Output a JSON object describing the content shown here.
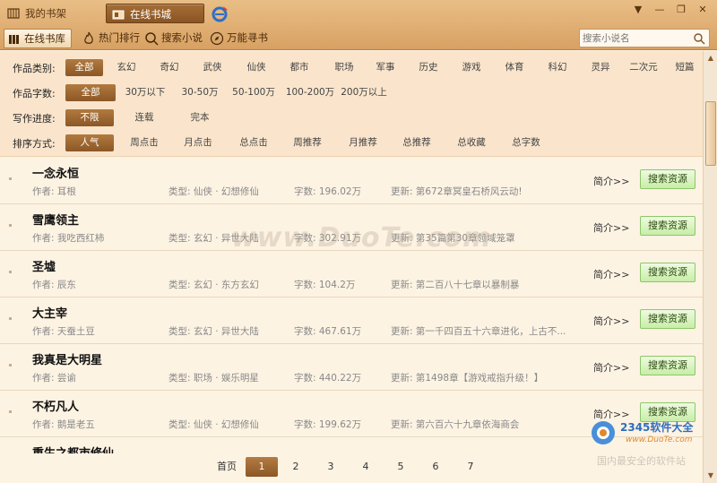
{
  "tabs": {
    "shelf": "我的书架",
    "online": "在线书城"
  },
  "window_controls": {
    "menu": "▼",
    "minimize": "—",
    "restore": "❐",
    "close": "✕"
  },
  "nav": {
    "library": "在线书库",
    "ranking": "热门排行",
    "search": "搜索小说",
    "finder": "万能寻书"
  },
  "search": {
    "placeholder": "搜索小说名"
  },
  "filters": {
    "category": {
      "label": "作品类别:",
      "options": [
        "全部",
        "玄幻",
        "奇幻",
        "武侠",
        "仙侠",
        "都市",
        "职场",
        "军事",
        "历史",
        "游戏",
        "体育",
        "科幻",
        "灵异",
        "二次元",
        "短篇"
      ]
    },
    "wordcount": {
      "label": "作品字数:",
      "options": [
        "全部",
        "30万以下",
        "30-50万",
        "50-100万",
        "100-200万",
        "200万以上"
      ]
    },
    "progress": {
      "label": "写作进度:",
      "options": [
        "不限",
        "连载",
        "完本"
      ]
    },
    "sort": {
      "label": "排序方式:",
      "options": [
        "人气",
        "周点击",
        "月点击",
        "总点击",
        "周推荐",
        "月推荐",
        "总推荐",
        "总收藏",
        "总字数"
      ]
    }
  },
  "books": [
    {
      "title": "一念永恒",
      "author": "作者: 耳根",
      "type": "类型: 仙侠 · 幻想修仙",
      "count": "字数: 196.02万",
      "update": "更新: 第672章冥皇石桥风云动!",
      "intro": "简介>>",
      "button": "搜索资源"
    },
    {
      "title": "雪鹰领主",
      "author": "作者: 我吃西红柿",
      "type": "类型: 玄幻 · 异世大陆",
      "count": "字数: 302.91万",
      "update": "更新: 第35篇第30章领域笼罩",
      "intro": "简介>>",
      "button": "搜索资源"
    },
    {
      "title": "圣墟",
      "author": "作者: 辰东",
      "type": "类型: 玄幻 · 东方玄幻",
      "count": "字数: 104.2万",
      "update": "更新: 第二百八十七章以暴制暴",
      "intro": "简介>>",
      "button": "搜索资源"
    },
    {
      "title": "大主宰",
      "author": "作者: 天蚕土豆",
      "type": "类型: 玄幻 · 异世大陆",
      "count": "字数: 467.61万",
      "update": "更新: 第一千四百五十六章进化，上古不...",
      "intro": "简介>>",
      "button": "搜索资源"
    },
    {
      "title": "我真是大明星",
      "author": "作者: 尝谕",
      "type": "类型: 职场 · 娱乐明星",
      "count": "字数: 440.22万",
      "update": "更新: 第1498章【游戏戒指升级！】",
      "intro": "简介>>",
      "button": "搜索资源"
    },
    {
      "title": "不朽凡人",
      "author": "作者: 鹅是老五",
      "type": "类型: 仙侠 · 幻想修仙",
      "count": "字数: 199.62万",
      "update": "更新: 第六百六十九章依海商会",
      "intro": "简介>>",
      "button": "搜索资源"
    },
    {
      "title": "重生之都市修仙",
      "author": "",
      "type": "",
      "count": "",
      "update": "",
      "intro": "",
      "button": ""
    }
  ],
  "pager": {
    "first": "首页",
    "pages": [
      "1",
      "2",
      "3",
      "4",
      "5",
      "6",
      "7"
    ],
    "current": "1"
  },
  "watermark": {
    "main": "www.DuoTe.com",
    "site_name": "2345软件大全",
    "site_url": "www.DuoTe.com",
    "site_sub": "国内最安全的软件站"
  },
  "colors": {
    "accent": "#8c5726",
    "titlebar": "#d8a163",
    "filter_bg": "#fae5cc",
    "list_bg": "#fdf3e3",
    "button_green": "#c8eda8"
  }
}
